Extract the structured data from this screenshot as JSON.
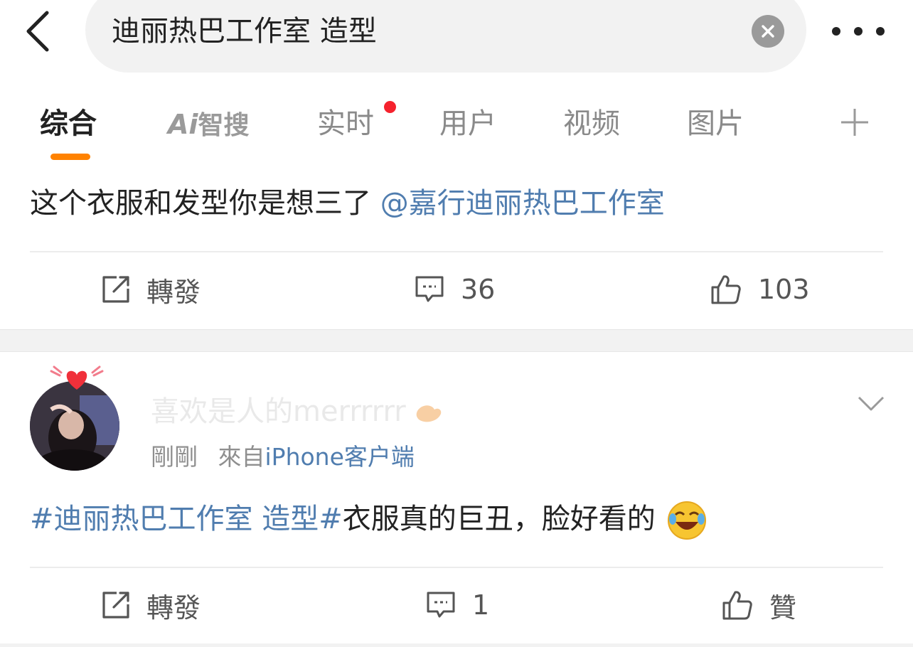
{
  "search": {
    "query": "迪丽热巴工作室 造型"
  },
  "tabs": [
    {
      "label": "综合"
    },
    {
      "label": "智搜",
      "logo_text": "Ai"
    },
    {
      "label": "实时"
    },
    {
      "label": "用户"
    },
    {
      "label": "视频"
    },
    {
      "label": "图片"
    }
  ],
  "posts": [
    {
      "text": "这个衣服和发型你是想三了",
      "mention": "@嘉行迪丽热巴工作室",
      "actions": {
        "repost": "轉發",
        "comments": "36",
        "likes": "103"
      }
    },
    {
      "username": "喜欢是人的merrrrrr",
      "time": "剛剛",
      "source_prefix": "來自",
      "source": "iPhone客户端",
      "hashtag": "#迪丽热巴工作室 造型#",
      "text": "衣服真的巨丑，脸好看的",
      "actions": {
        "repost": "轉發",
        "comments": "1",
        "likes": "贊"
      }
    }
  ],
  "colors": {
    "accent": "#ff8200",
    "link": "#507daf",
    "notification_dot": "#f5222d"
  },
  "icons": [
    "back-arrow-icon",
    "clear-icon",
    "more-icon",
    "plus-icon",
    "repost-icon",
    "comment-icon",
    "like-icon",
    "chevron-down-icon",
    "laughing-emoji-icon"
  ]
}
